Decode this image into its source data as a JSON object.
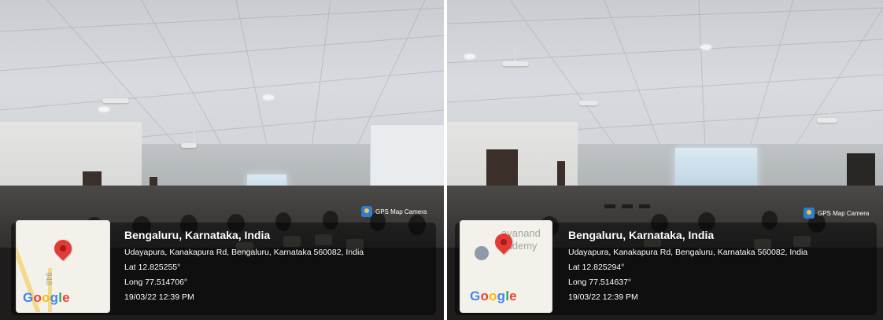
{
  "photos": [
    {
      "badge": "GPS Map Camera",
      "map_road_label": "948",
      "map_place_label": "",
      "google": "Google",
      "title": "Bengaluru, Karnataka, India",
      "address": "Udayapura, Kanakapura Rd, Bengaluru, Karnataka 560082, India",
      "lat": "Lat 12.825255°",
      "long": "Long 77.514706°",
      "datetime": "19/03/22 12:39 PM"
    },
    {
      "badge": "GPS Map Camera",
      "map_road_label": "",
      "map_place_label": "ayanand\ncademy",
      "google": "Google",
      "title": "Bengaluru, Karnataka, India",
      "address": "Udayapura, Kanakapura Rd, Bengaluru, Karnataka 560082, India",
      "lat": "Lat 12.825294°",
      "long": "Long 77.514637°",
      "datetime": "19/03/22 12:39 PM"
    }
  ],
  "colors": {
    "pin": "#e53935",
    "google_blue": "#4285F4",
    "google_red": "#EA4335",
    "google_yellow": "#FBBC05",
    "google_green": "#34A853"
  },
  "icons": [
    "map-pin-icon",
    "gps-camera-icon"
  ]
}
